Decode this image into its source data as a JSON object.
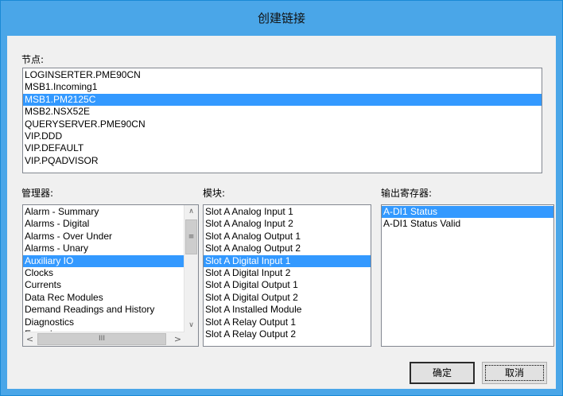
{
  "dialog": {
    "title": "创建链接"
  },
  "nodes": {
    "label": "节点:",
    "items": [
      "LOGINSERTER.PME90CN",
      "MSB1.Incoming1",
      "MSB1.PM2125C",
      "MSB2.NSX52E",
      "QUERYSERVER.PME90CN",
      "VIP.DDD",
      "VIP.DEFAULT",
      "VIP.PQADVISOR"
    ],
    "selected_index": 2
  },
  "managers": {
    "label": "管理器:",
    "items": [
      "Alarm - Summary",
      "Alarms - Digital",
      "Alarms - Over Under",
      "Alarms - Unary",
      "Auxiliary IO",
      "Clocks",
      "Currents",
      "Data Rec Modules",
      "Demand Readings and History",
      "Diagnostics",
      "Energies"
    ],
    "selected_index": 4,
    "scroll_up_glyph": "∧",
    "scroll_down_glyph": "∨",
    "scroll_left_glyph": "<",
    "scroll_right_glyph": ">",
    "v_thumb_grip": "≡",
    "h_thumb_grip": "III"
  },
  "modules": {
    "label": "模块:",
    "items": [
      "Slot A Analog Input 1",
      "Slot A Analog Input 2",
      "Slot A Analog Output 1",
      "Slot A Analog Output 2",
      "Slot A Digital Input 1",
      "Slot A Digital Input 2",
      "Slot A Digital Output 1",
      "Slot A Digital Output 2",
      "Slot A Installed Module",
      "Slot A Relay Output 1",
      "Slot A Relay Output 2"
    ],
    "selected_index": 4
  },
  "output_registers": {
    "label": "输出寄存器:",
    "items": [
      "A-DI1 Status",
      "A-DI1 Status Valid"
    ],
    "selected_index": 0
  },
  "buttons": {
    "ok": "确定",
    "cancel": "取消"
  },
  "colors": {
    "titlebar": "#4aa6e8",
    "selection": "#3399ff",
    "dialog_bg": "#f0f0f0"
  }
}
